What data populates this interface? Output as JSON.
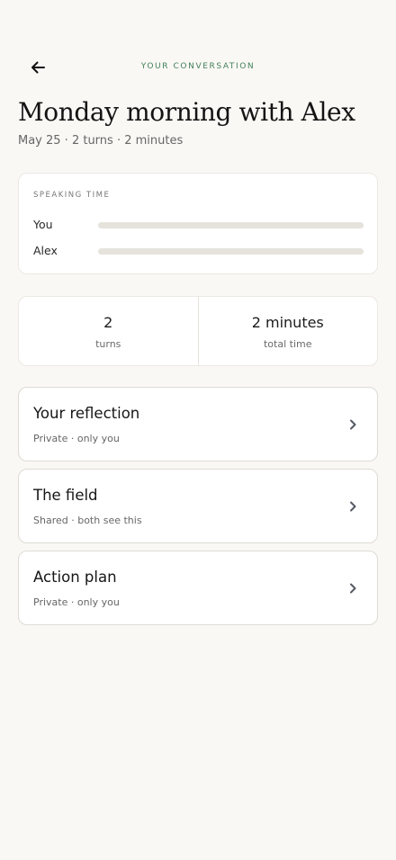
{
  "header": {
    "back_icon": "arrow-left-icon",
    "eyebrow": "YOUR CONVERSATION"
  },
  "conversation": {
    "title": "Monday morning with Alex",
    "meta": "May 25 · 2 turns · 2 minutes"
  },
  "speaking_time": {
    "label": "SPEAKING TIME",
    "rows": [
      {
        "name": "You",
        "share": 0
      },
      {
        "name": "Alex",
        "share": 0
      }
    ]
  },
  "stats": [
    {
      "value": "2",
      "label": "turns"
    },
    {
      "value": "2 minutes",
      "label": "total time"
    }
  ],
  "sections": [
    {
      "title": "Your reflection",
      "subtitle": "Private · only you",
      "icon": "chevron-right-icon"
    },
    {
      "title": "The field",
      "subtitle": "Shared · both see this",
      "icon": "chevron-right-icon"
    },
    {
      "title": "Action plan",
      "subtitle": "Private · only you",
      "icon": "chevron-right-icon"
    }
  ],
  "colors": {
    "accent": "#3f7f57",
    "background": "#faf8f5",
    "card": "#ffffff",
    "track": "#e5e3dc"
  }
}
